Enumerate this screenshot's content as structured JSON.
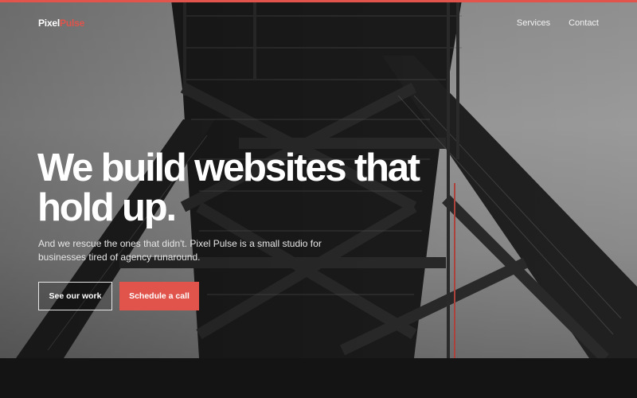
{
  "brand": {
    "name_part1": "Pixel",
    "name_part2": "Pulse",
    "accent_color": "#e0544c"
  },
  "nav": {
    "links": [
      "Services",
      "Contact"
    ]
  },
  "hero": {
    "headline": "We build websites that hold up.",
    "subtext": "And we rescue the ones that didn't. Pixel Pulse is a small studio for businesses tired of agency runaround.",
    "image_subject": "steel truss tower (black and white)"
  },
  "actions": {
    "secondary_label": "See our work",
    "primary_label": "Schedule a call"
  },
  "icons": []
}
